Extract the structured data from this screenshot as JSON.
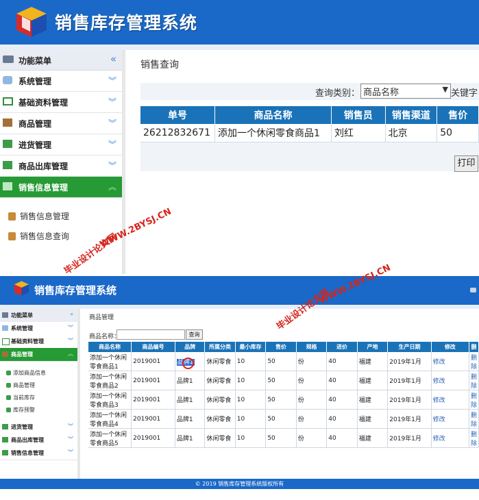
{
  "top": {
    "app_title": "销售库存管理系统",
    "menu_header": "功能菜单",
    "menu_items": [
      {
        "label": "系统管理"
      },
      {
        "label": "基础资料管理"
      },
      {
        "label": "商品管理"
      },
      {
        "label": "进货管理"
      },
      {
        "label": "商品出库管理"
      },
      {
        "label": "销售信息管理"
      }
    ],
    "submenu": [
      "销售信息管理",
      "销售信息查询"
    ],
    "breadcrumb": "销售查询",
    "query_label": "查询类别：",
    "query_select_value": "商品名称",
    "keyword_label": "关键字",
    "table": {
      "headers": [
        "单号",
        "商品名称",
        "销售员",
        "销售渠道",
        "售价"
      ],
      "rows": [
        [
          "26212832671",
          "添加一个休闲零食商品1",
          "刘红",
          "北京",
          "50"
        ]
      ]
    },
    "print_button": "打印"
  },
  "bottom": {
    "app_title": "销售库存管理系统",
    "menu_header": "功能菜单",
    "menu_items_top": [
      {
        "label": "系统管理"
      },
      {
        "label": "基础资料管理"
      },
      {
        "label": "商品管理"
      }
    ],
    "submenu": [
      "添加商品信息",
      "商品管理",
      "当前库存",
      "库存预警"
    ],
    "menu_items_bottom": [
      {
        "label": "进货管理"
      },
      {
        "label": "商品出库管理"
      },
      {
        "label": "销售信息管理"
      }
    ],
    "breadcrumb": "商品管理",
    "name_label": "商品名称：",
    "search_button": "查询",
    "table": {
      "headers": [
        "商品名称",
        "商品编号",
        "品牌",
        "所属分类",
        "最小库存",
        "售价",
        "规格",
        "进价",
        "产地",
        "生产日期",
        "修改",
        "删"
      ],
      "rows": [
        [
          "添加一个休闲零食商品1",
          "2019001",
          "品牌1",
          "休闲零食",
          "10",
          "50",
          "份",
          "40",
          "福建",
          "2019年1月",
          "修改",
          "删除"
        ],
        [
          "添加一个休闲零食商品2",
          "2019001",
          "品牌1",
          "休闲零食",
          "10",
          "50",
          "份",
          "40",
          "福建",
          "2019年1月",
          "修改",
          "删除"
        ],
        [
          "添加一个休闲零食商品3",
          "2019001",
          "品牌1",
          "休闲零食",
          "10",
          "50",
          "份",
          "40",
          "福建",
          "2019年1月",
          "修改",
          "删除"
        ],
        [
          "添加一个休闲零食商品4",
          "2019001",
          "品牌1",
          "休闲零食",
          "10",
          "50",
          "份",
          "40",
          "福建",
          "2019年1月",
          "修改",
          "删除"
        ],
        [
          "添加一个休闲零食商品5",
          "2019001",
          "品牌1",
          "休闲零食",
          "10",
          "50",
          "份",
          "40",
          "福建",
          "2019年1月",
          "修改",
          "删除"
        ]
      ]
    },
    "footer": "© 2019 销售库存管理系统版权所有"
  },
  "watermarks": {
    "cn": "毕业设计论文网",
    "url_upper": "WWW.2BYSJ.CN",
    "url_lower": "WWW.2BYSJ.CN"
  },
  "colors": {
    "header_blue": "#1a69c8",
    "table_header": "#1a73b8",
    "active_green": "#269a34",
    "watermark_red": "#d6241c",
    "link_blue": "#2a62b8"
  }
}
